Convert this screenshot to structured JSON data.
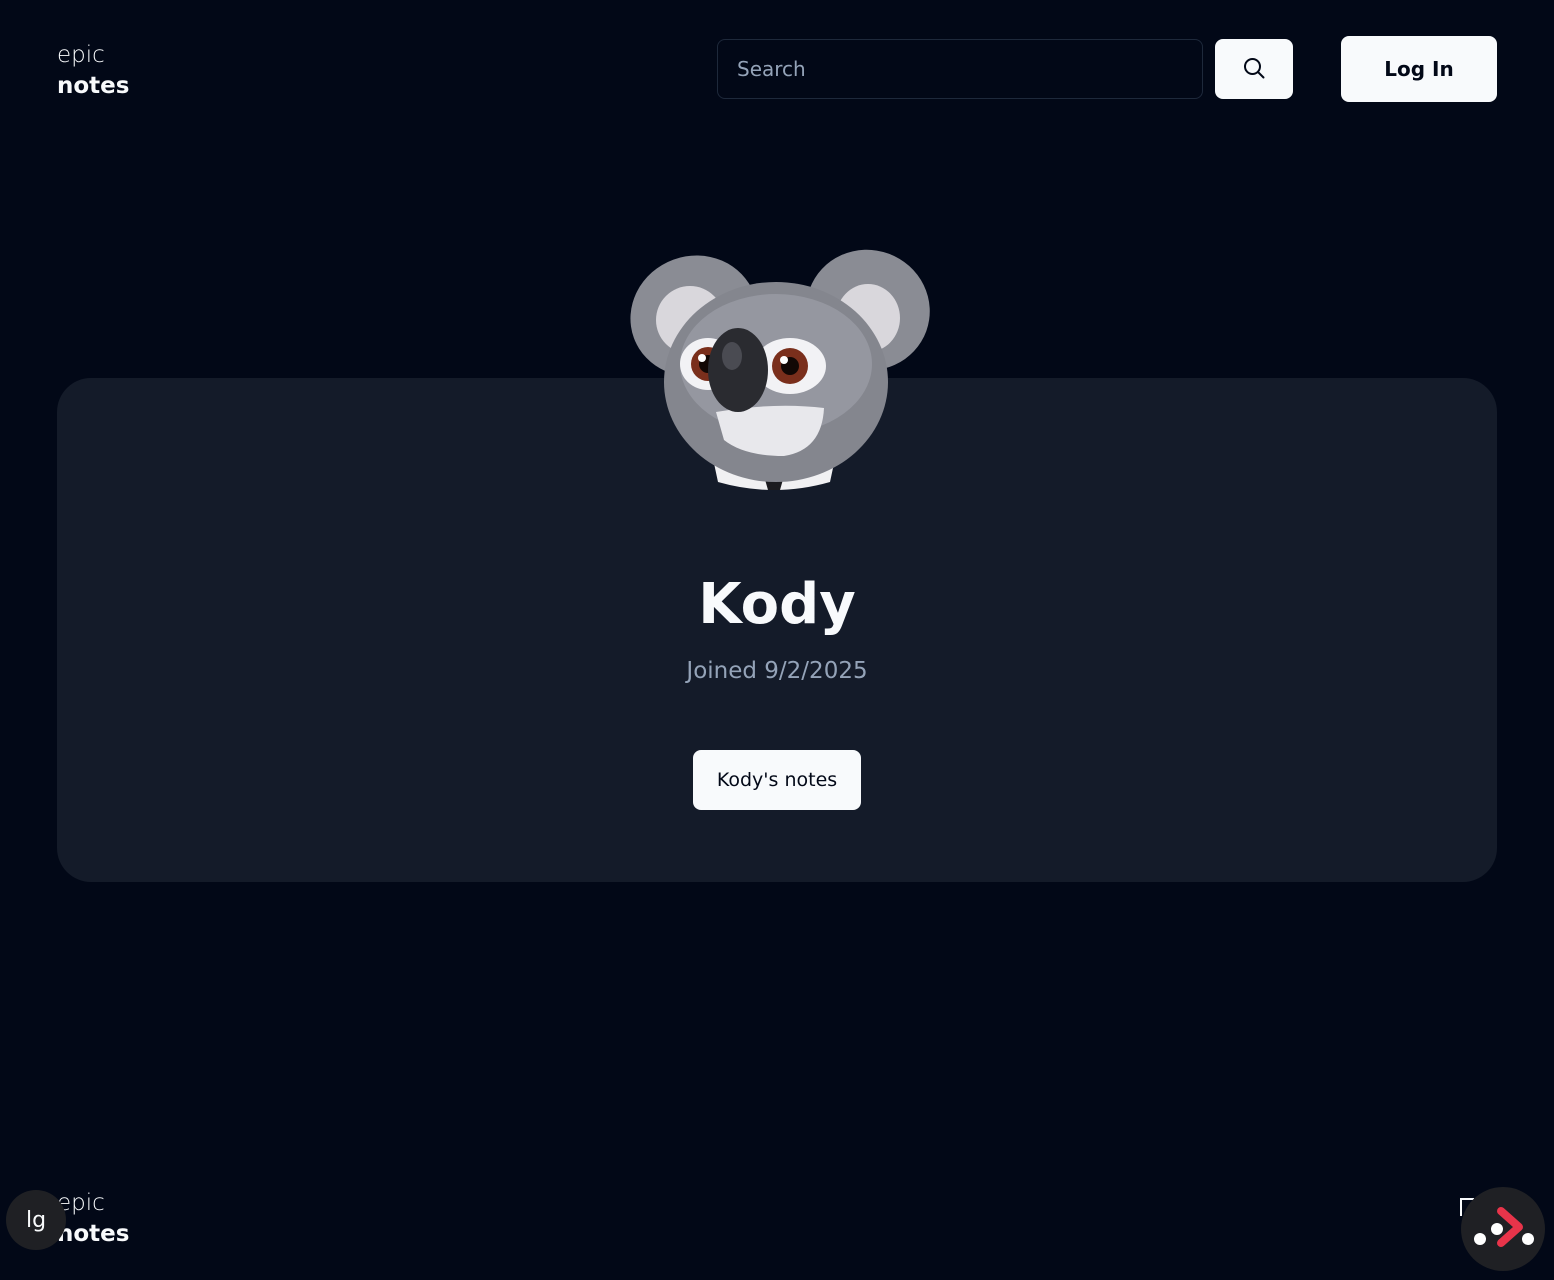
{
  "header": {
    "logo": {
      "line1": "epic",
      "line2": "notes"
    },
    "search": {
      "placeholder": "Search"
    },
    "login_label": "Log In"
  },
  "profile": {
    "name": "Kody",
    "joined": "Joined 9/2/2025",
    "notes_button_label": "Kody's notes",
    "avatar": "koala-avatar"
  },
  "footer": {
    "logo": {
      "line1": "epic",
      "line2": "notes"
    },
    "breakpoint": "lg"
  },
  "colors": {
    "background": "#020817",
    "card": "#141b29",
    "button": "#f8fafc",
    "muted_text": "#94a3b8",
    "devtools_accent": "#e8344a"
  }
}
